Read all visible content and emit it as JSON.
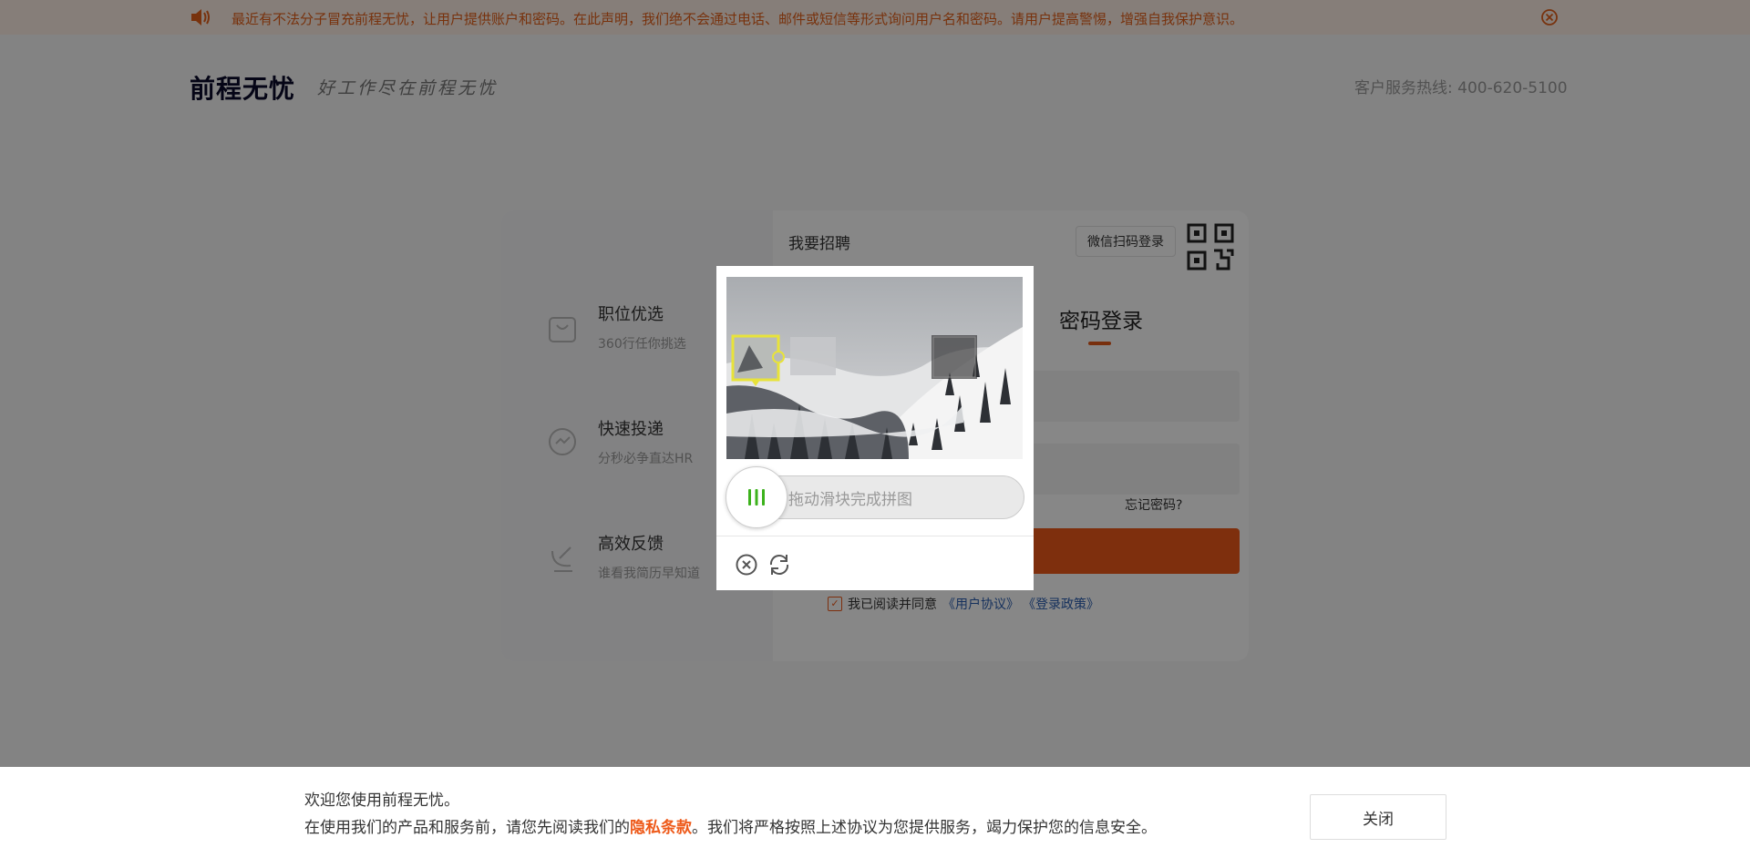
{
  "notice": {
    "text": "最近有不法分子冒充前程无忧，让用户提供账户和密码。在此声明，我们绝不会通过电话、邮件或短信等形式询问用户名和密码。请用户提高警惕，增强自我保护意识。"
  },
  "header": {
    "logo": "前程无忧",
    "slogan": "好工作尽在前程无忧",
    "hotline": "客户服务热线: 400-620-5100"
  },
  "features": [
    {
      "title": "职位优选",
      "subtitle": "360行任你挑选"
    },
    {
      "title": "快速投递",
      "subtitle": "分秒必争直达HR"
    },
    {
      "title": "高效反馈",
      "subtitle": "谁看我简历早知道"
    }
  ],
  "login": {
    "recruit_label": "我要招聘",
    "wechat_label": "微信扫码登录",
    "password_tab": "密码登录",
    "forgot": "忘记密码?",
    "agree_prefix": "我已阅读并同意",
    "user_agreement": "《用户协议》",
    "login_policy": "《登录政策》"
  },
  "captcha": {
    "slider_hint": "拖动滑块完成拼图"
  },
  "bottom": {
    "line1": "欢迎您使用前程无忧。",
    "line2_prefix": "在使用我们的产品和服务前，请您先阅读我们的",
    "line2_link": "隐私条款",
    "line2_suffix": "。我们将严格按照上述协议为您提供服务，竭力保护您的信息安全。",
    "close_label": "关闭"
  },
  "colors": {
    "accent": "#ee5a1a",
    "link": "#2a5db0",
    "slider_green": "#3cb21c"
  }
}
